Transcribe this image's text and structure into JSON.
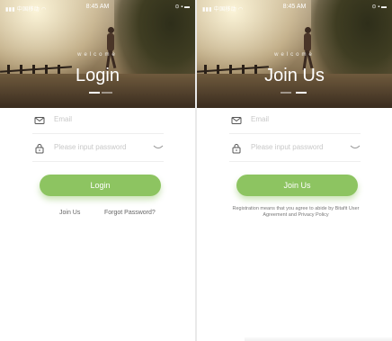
{
  "status_bar": {
    "carrier": "中国移动",
    "time": "8:45 AM",
    "right": "⊙ ▪ ▬"
  },
  "login_screen": {
    "welcome": "welcome",
    "title": "Login",
    "email_placeholder": "Email",
    "password_placeholder": "Please input password",
    "button_label": "Login",
    "join_link": "Join Us",
    "forgot_link": "Forgot Password?"
  },
  "join_screen": {
    "welcome": "welcome",
    "title": "Join Us",
    "email_placeholder": "Email",
    "password_placeholder": "Please input password",
    "button_label": "Join Us",
    "terms": "Registration means that you agree to abide by Bitafit User Agreement and Privacy Policy"
  },
  "colors": {
    "accent": "#8dc461",
    "placeholder": "#c8c8c8",
    "link": "#666666"
  },
  "icons": [
    "signal-icon",
    "wifi-icon",
    "mail-icon",
    "lock-icon",
    "eye-closed-icon"
  ]
}
